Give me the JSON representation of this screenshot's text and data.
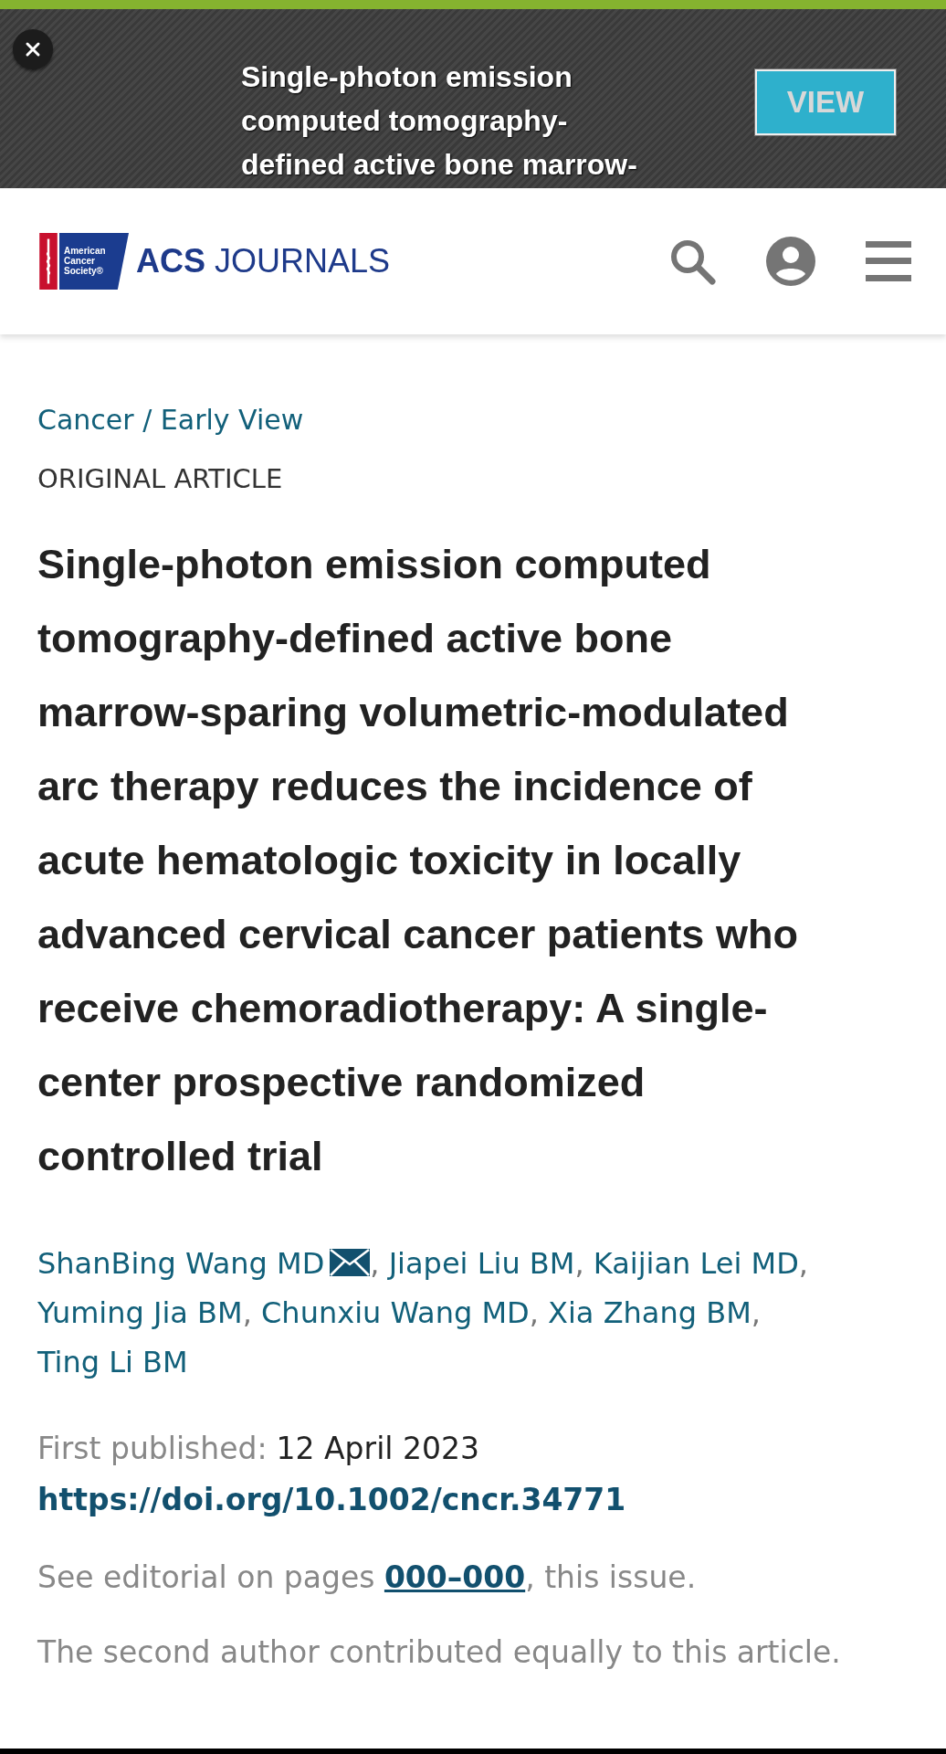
{
  "banner": {
    "title": "Single-photon emission\ncomputed tomography-\ndefined active bone marrow-",
    "button": "VIEW"
  },
  "header": {
    "logo_text": "American\nCancer\nSociety®",
    "brand": "**ACS** JOURNALS"
  },
  "article": {
    "breadcrumb": "Cancer / Early View",
    "type": "ORIGINAL ARTICLE",
    "title": "Single-photon emission computed\ntomography-defined active bone\nmarrow-sparing volumetric-modulated\narc therapy reduces the incidence of\nacute hematologic toxicity in locally\nadvanced cervical cancer patients who\nreceive chemoradiotherapy: A single-\ncenter prospective randomized\ncontrolled trial",
    "separator": ",",
    "authors": [
      {
        "name": "ShanBing Wang MD",
        "corresponding": true
      },
      {
        "name": "Jiapei Liu BM",
        "corresponding": false
      },
      {
        "name": "Kaijian Lei MD",
        "corresponding": false
      },
      {
        "name": "Yuming Jia BM",
        "corresponding": false
      },
      {
        "name": "Chunxiu Wang MD",
        "corresponding": false
      },
      {
        "name": "Xia Zhang BM",
        "corresponding": false
      },
      {
        "name": "Ting Li BM",
        "corresponding": false
      }
    ],
    "published_label": "First published:",
    "published_date": "12 April 2023",
    "doi": "https://doi.org/10.1002/cncr.34771",
    "editorial": {
      "before": "See editorial on pages ",
      "link": "000–000",
      "after": ", this issue."
    },
    "note": "The second author contributed equally to this article."
  }
}
